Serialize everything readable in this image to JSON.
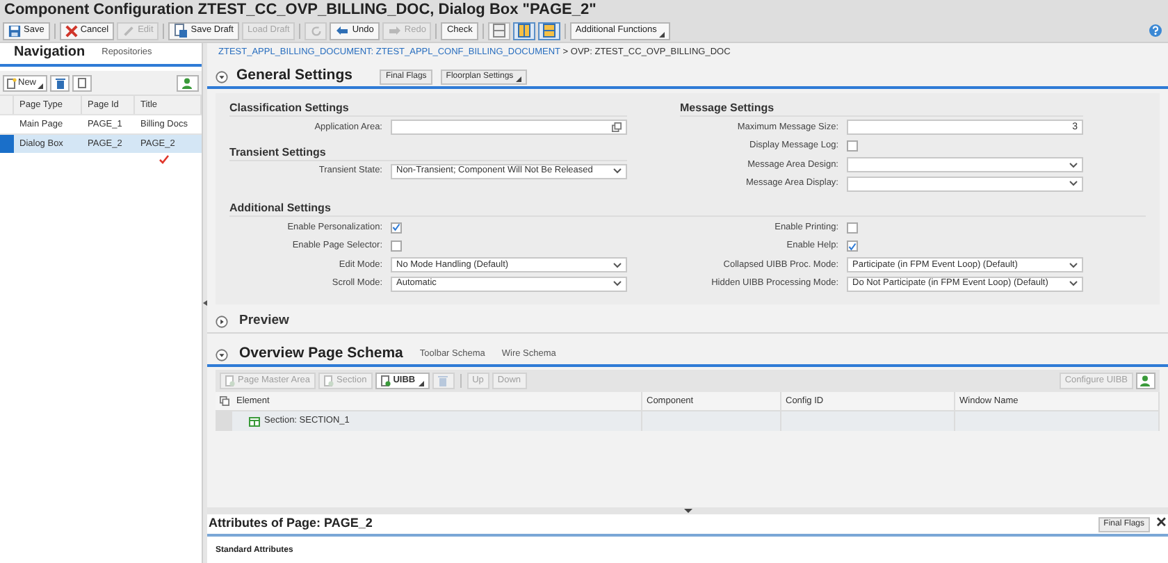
{
  "window": {
    "title": "Component Configuration ZTEST_CC_OVP_BILLING_DOC, Dialog Box \"PAGE_2\""
  },
  "toolbar": {
    "groups": [
      [
        {
          "kind": "button",
          "label": "Save",
          "disabled": false
        }
      ],
      [
        {
          "kind": "button",
          "label": "Cancel",
          "disabled": false
        },
        {
          "kind": "button",
          "label": "Edit",
          "disabled": true
        }
      ],
      [
        {
          "kind": "button",
          "label": "Save Draft",
          "disabled": false
        },
        {
          "kind": "button",
          "label": "Load Draft",
          "disabled": true
        }
      ],
      [
        {
          "kind": "icon",
          "disabled": true
        },
        {
          "kind": "button",
          "label": "Undo",
          "disabled": false
        },
        {
          "kind": "button",
          "label": "Redo",
          "disabled": true
        }
      ],
      [
        {
          "kind": "button",
          "label": "Check",
          "disabled": false
        }
      ],
      [
        {
          "kind": "layout",
          "selected": false
        },
        {
          "kind": "layout",
          "selected": true
        },
        {
          "kind": "layout",
          "selected": true
        }
      ],
      [
        {
          "kind": "menu",
          "label": "Additional Functions",
          "disabled": false
        }
      ]
    ]
  },
  "navigation": {
    "tabs": [
      {
        "label": "Navigation",
        "selected": true
      },
      {
        "label": "Repositories",
        "selected": false
      }
    ],
    "new_button": "New",
    "columns": [
      "Page Type",
      "Page Id",
      "Title"
    ],
    "rows": [
      {
        "cells": [
          "Main Page",
          "PAGE_1",
          "Billing Docs"
        ],
        "selected": false
      },
      {
        "cells": [
          "Dialog Box",
          "PAGE_2",
          "PAGE_2"
        ],
        "selected": true
      }
    ]
  },
  "breadcrumb": {
    "link": "ZTEST_APPL_BILLING_DOCUMENT: ZTEST_APPL_CONF_BILLING_DOCUMENT",
    "rest": " > OVP: ZTEST_CC_OVP_BILLING_DOC"
  },
  "general_settings": {
    "title": "General Settings",
    "expanded": true,
    "buttons": [
      {
        "label": "Final Flags",
        "menu": false
      },
      {
        "label": "Floorplan Settings",
        "menu": true
      }
    ],
    "left": [
      {
        "kind": "heading",
        "label": "Classification Settings"
      },
      {
        "kind": "text",
        "label": "Application Area:",
        "help": true
      },
      {
        "kind": "heading",
        "label": "Transient Settings"
      },
      {
        "kind": "select",
        "label": "Transient State:",
        "value": "Non-Transient; Component Will Not Be Released"
      }
    ],
    "right": [
      {
        "kind": "heading",
        "label": "Message Settings"
      },
      {
        "kind": "number",
        "label": "Maximum Message Size:",
        "value": "3"
      },
      {
        "kind": "checkbox",
        "label": "Display Message Log:",
        "checked": false
      },
      {
        "kind": "select",
        "label": "Message Area Design:"
      },
      {
        "kind": "select",
        "label": "Message Area Display:"
      }
    ],
    "additional_title": "Additional Settings",
    "additional_left": [
      {
        "kind": "checkbox",
        "label": "Enable Personalization:",
        "checked": true
      },
      {
        "kind": "checkbox",
        "label": "Enable Page Selector:",
        "checked": false
      },
      {
        "kind": "select",
        "label": "Edit Mode:",
        "value": "No Mode Handling (Default)"
      },
      {
        "kind": "select",
        "label": "Scroll Mode:",
        "value": "Automatic"
      }
    ],
    "additional_right": [
      {
        "kind": "checkbox",
        "label": "Enable Printing:",
        "checked": false
      },
      {
        "kind": "checkbox",
        "label": "Enable Help:",
        "checked": true
      },
      {
        "kind": "select",
        "label": "Collapsed UIBB Proc. Mode:",
        "value": "Participate (in FPM Event Loop) (Default)"
      },
      {
        "kind": "select",
        "label": "Hidden UIBB Processing Mode:",
        "value": "Do Not Participate (in FPM Event Loop) (Default)"
      }
    ]
  },
  "preview": {
    "title": "Preview",
    "expanded": false
  },
  "schema": {
    "title": "Overview Page Schema",
    "expanded": true,
    "tabs": [
      {
        "label": "Toolbar Schema",
        "selected": false
      },
      {
        "label": "Wire Schema",
        "selected": false
      }
    ],
    "toolbar": [
      {
        "label": "Page Master Area",
        "disabled": true,
        "menu": false
      },
      {
        "label": "Section",
        "disabled": true,
        "menu": false
      },
      {
        "label": "UIBB",
        "disabled": false,
        "menu": true
      }
    ],
    "moves": [
      {
        "label": "Up",
        "disabled": true
      },
      {
        "label": "Down",
        "disabled": true
      }
    ],
    "configure": {
      "label": "Configure UIBB",
      "disabled": true
    },
    "columns": [
      "Element",
      "Component",
      "Config ID",
      "Window Name"
    ],
    "rows": [
      {
        "cells": [
          "Section: SECTION_1",
          "",
          "",
          ""
        ]
      }
    ]
  },
  "attributes": {
    "title": "Attributes of Page: PAGE_2",
    "button": "Final Flags",
    "close": "✕",
    "subtitle": "Standard Attributes"
  }
}
